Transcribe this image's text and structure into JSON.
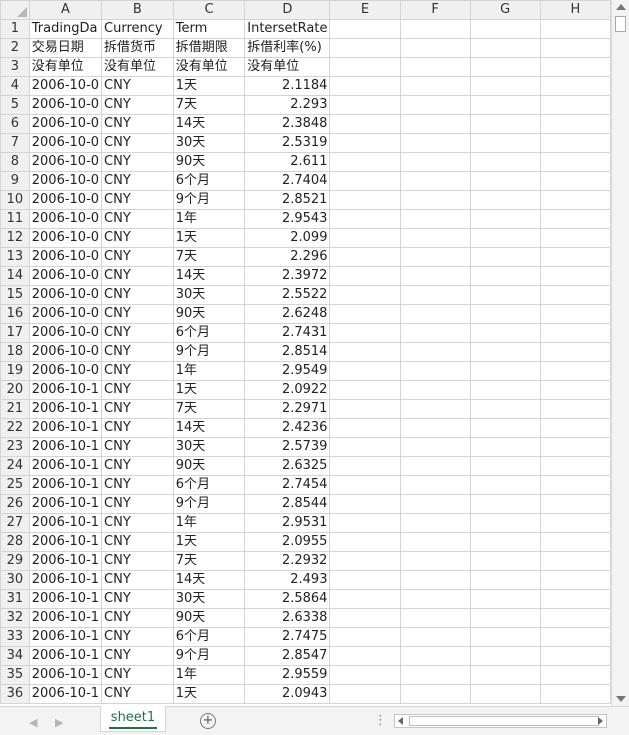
{
  "columns": [
    "A",
    "B",
    "C",
    "D",
    "E",
    "F",
    "G",
    "H"
  ],
  "header_rows": [
    [
      "TradingDa",
      "Currency",
      "Term",
      "IntersetRate"
    ],
    [
      "交易日期",
      "拆借货币",
      "拆借期限",
      "拆借利率(%)"
    ],
    [
      "没有单位",
      "没有单位",
      "没有单位",
      "没有单位"
    ]
  ],
  "data_rows": [
    [
      "2006-10-0",
      "CNY",
      "1天",
      "2.1184"
    ],
    [
      "2006-10-0",
      "CNY",
      "7天",
      "2.293"
    ],
    [
      "2006-10-0",
      "CNY",
      "14天",
      "2.3848"
    ],
    [
      "2006-10-0",
      "CNY",
      "30天",
      "2.5319"
    ],
    [
      "2006-10-0",
      "CNY",
      "90天",
      "2.611"
    ],
    [
      "2006-10-0",
      "CNY",
      "6个月",
      "2.7404"
    ],
    [
      "2006-10-0",
      "CNY",
      "9个月",
      "2.8521"
    ],
    [
      "2006-10-0",
      "CNY",
      "1年",
      "2.9543"
    ],
    [
      "2006-10-0",
      "CNY",
      "1天",
      "2.099"
    ],
    [
      "2006-10-0",
      "CNY",
      "7天",
      "2.296"
    ],
    [
      "2006-10-0",
      "CNY",
      "14天",
      "2.3972"
    ],
    [
      "2006-10-0",
      "CNY",
      "30天",
      "2.5522"
    ],
    [
      "2006-10-0",
      "CNY",
      "90天",
      "2.6248"
    ],
    [
      "2006-10-0",
      "CNY",
      "6个月",
      "2.7431"
    ],
    [
      "2006-10-0",
      "CNY",
      "9个月",
      "2.8514"
    ],
    [
      "2006-10-0",
      "CNY",
      "1年",
      "2.9549"
    ],
    [
      "2006-10-1",
      "CNY",
      "1天",
      "2.0922"
    ],
    [
      "2006-10-1",
      "CNY",
      "7天",
      "2.2971"
    ],
    [
      "2006-10-1",
      "CNY",
      "14天",
      "2.4236"
    ],
    [
      "2006-10-1",
      "CNY",
      "30天",
      "2.5739"
    ],
    [
      "2006-10-1",
      "CNY",
      "90天",
      "2.6325"
    ],
    [
      "2006-10-1",
      "CNY",
      "6个月",
      "2.7454"
    ],
    [
      "2006-10-1",
      "CNY",
      "9个月",
      "2.8544"
    ],
    [
      "2006-10-1",
      "CNY",
      "1年",
      "2.9531"
    ],
    [
      "2006-10-1",
      "CNY",
      "1天",
      "2.0955"
    ],
    [
      "2006-10-1",
      "CNY",
      "7天",
      "2.2932"
    ],
    [
      "2006-10-1",
      "CNY",
      "14天",
      "2.493"
    ],
    [
      "2006-10-1",
      "CNY",
      "30天",
      "2.5864"
    ],
    [
      "2006-10-1",
      "CNY",
      "90天",
      "2.6338"
    ],
    [
      "2006-10-1",
      "CNY",
      "6个月",
      "2.7475"
    ],
    [
      "2006-10-1",
      "CNY",
      "9个月",
      "2.8547"
    ],
    [
      "2006-10-1",
      "CNY",
      "1年",
      "2.9559"
    ],
    [
      "2006-10-1",
      "CNY",
      "1天",
      "2.0943"
    ]
  ],
  "sheet_tabs": [
    {
      "label": "sheet1",
      "active": true
    }
  ],
  "icons": {
    "add_sheet": "plus-circle-icon",
    "options": "vertical-ellipsis-icon",
    "tab_prev": "triangle-left-icon",
    "tab_next": "triangle-right-icon"
  },
  "colors": {
    "accent": "#217346",
    "grid": "#d4d4d4",
    "header_bg": "#f0f0f0"
  }
}
